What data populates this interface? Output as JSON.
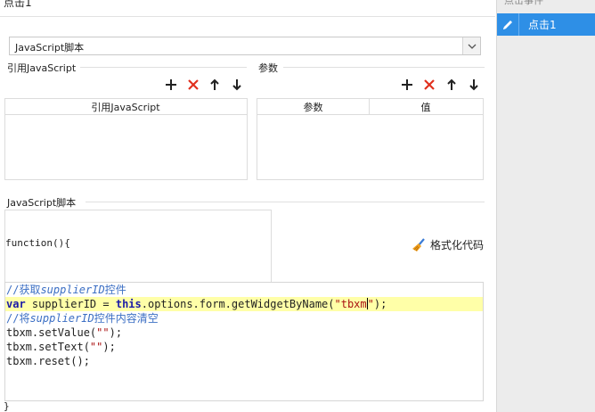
{
  "dialog": {
    "title": "点击1",
    "script_type": {
      "selected": "JavaScript脚本"
    }
  },
  "ref_js": {
    "group_title": "引用JavaScript",
    "columns": [
      "引用JavaScript"
    ]
  },
  "params": {
    "group_title": "参数",
    "columns": [
      "参数",
      "值"
    ]
  },
  "script": {
    "group_title": "JavaScript脚本",
    "format_label": "格式化代码",
    "function_open": "function(){",
    "function_close": "}",
    "code": {
      "line1_prefix": "//获取",
      "line1_ital": "supplierID",
      "line1_suffix": "控件",
      "line2_kw1": "var",
      "line2_a": " supplierID = ",
      "line2_kw2": "this",
      "line2_b": ".options.form.getWidgetByName(",
      "line2_str_a": "\"tbxm",
      "line2_str_b": "\"",
      "line2_end": ");",
      "line3_prefix": "//将",
      "line3_ital": "supplierID",
      "line3_suffix": "控件内容清空",
      "line4_a": "tbxm.setValue(",
      "line4_str": "\"\"",
      "line4_end": ");",
      "line5_a": "tbxm.setText(",
      "line5_str": "\"\"",
      "line5_end": ");",
      "line6": "tbxm.reset();"
    }
  },
  "events": {
    "header": "点击事件",
    "items": [
      {
        "label": "点击1"
      }
    ]
  },
  "colors": {
    "accent": "#2e8fe6",
    "delete_red": "#e0301e",
    "comment": "#3c6fc4",
    "keyword": "#1a1aa6",
    "string": "#aa1111",
    "active_line": "#ffffa8"
  }
}
